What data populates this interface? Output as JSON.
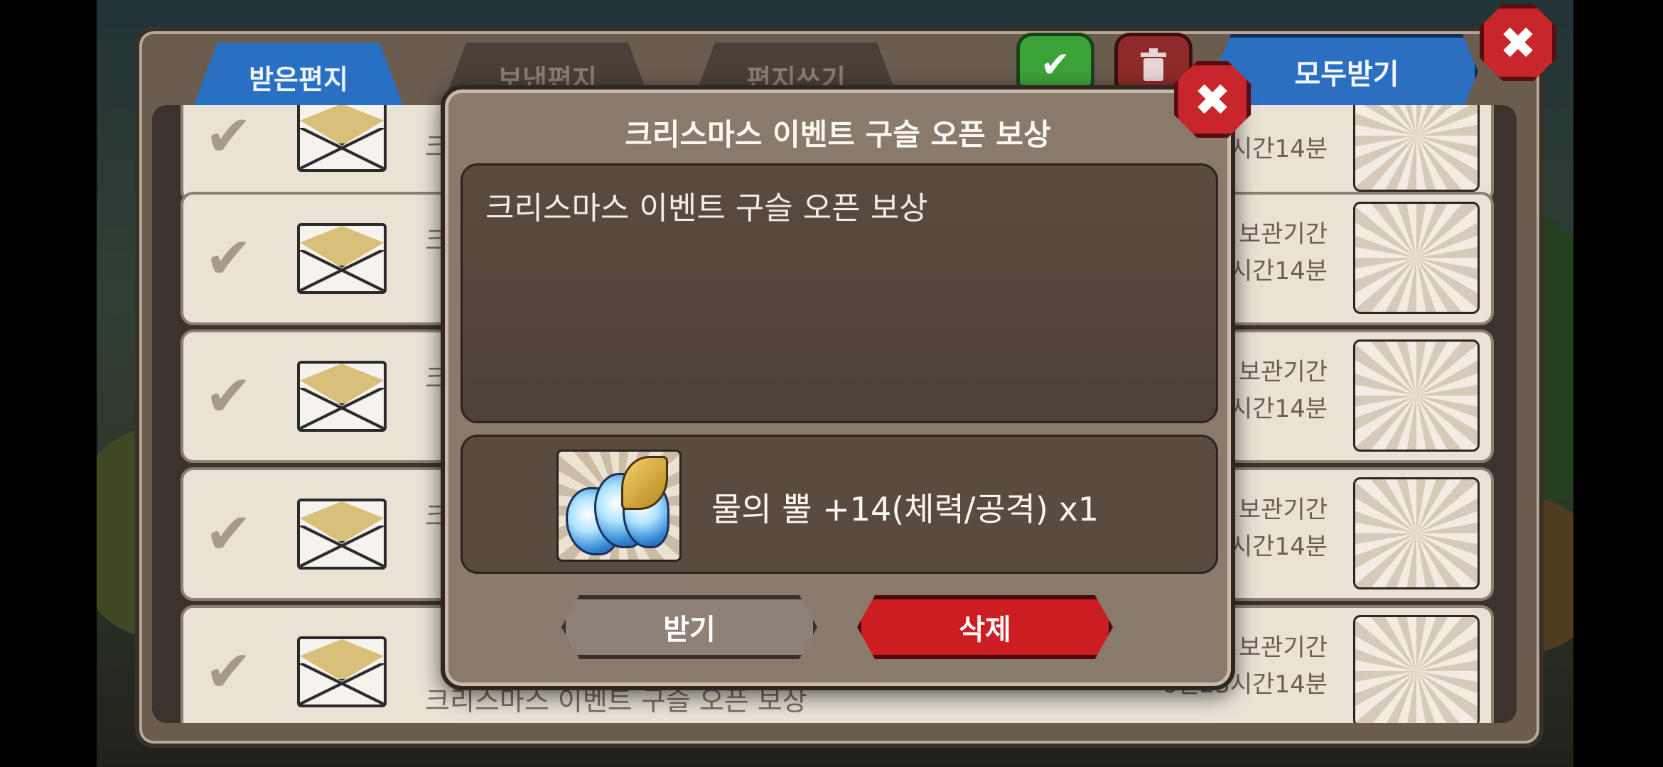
{
  "tabs": [
    {
      "label": "받은편지"
    },
    {
      "label": "보낸편지"
    },
    {
      "label": "편지쓰기"
    }
  ],
  "toolbar": {
    "receive_all_label": "모두받기",
    "check_icon": "check-icon",
    "trash_icon": "trash-icon",
    "close_icon": "close-icon"
  },
  "mail_list": {
    "rows": [
      {
        "check": "✔",
        "subject": "크",
        "keep_line1": "",
        "keep_line2": "시간14분",
        "thumb": "sword"
      },
      {
        "check": "✔",
        "subject": "크",
        "keep_line1": "보관기간",
        "keep_line2": "시간14분",
        "thumb": "vase"
      },
      {
        "check": "✔",
        "subject": "크",
        "keep_line1": "보관기간",
        "keep_line2": "시간14분",
        "thumb": "dark-beast"
      },
      {
        "check": "✔",
        "subject": "크",
        "keep_line1": "보관기간",
        "keep_line2": "시간14분",
        "thumb": "water-horn"
      },
      {
        "check": "✔",
        "subject": "크리스마스 이벤트 구슬 오픈 보상",
        "keep_line1": "보관기간",
        "keep_line2": "6일23시간14분",
        "thumb": "potion"
      }
    ]
  },
  "modal": {
    "title": "크리스마스 이벤트 구슬 오픈 보상",
    "message": "크리스마스 이벤트 구슬 오픈 보상",
    "item_text": "물의 뿔 +14(체력/공격) x1",
    "receive_label": "받기",
    "delete_label": "삭제",
    "close_glyph": "✖"
  },
  "colors": {
    "tab_active": "#2a70c2",
    "delete_button": "#cc1d22",
    "close_button": "#c8262c"
  }
}
